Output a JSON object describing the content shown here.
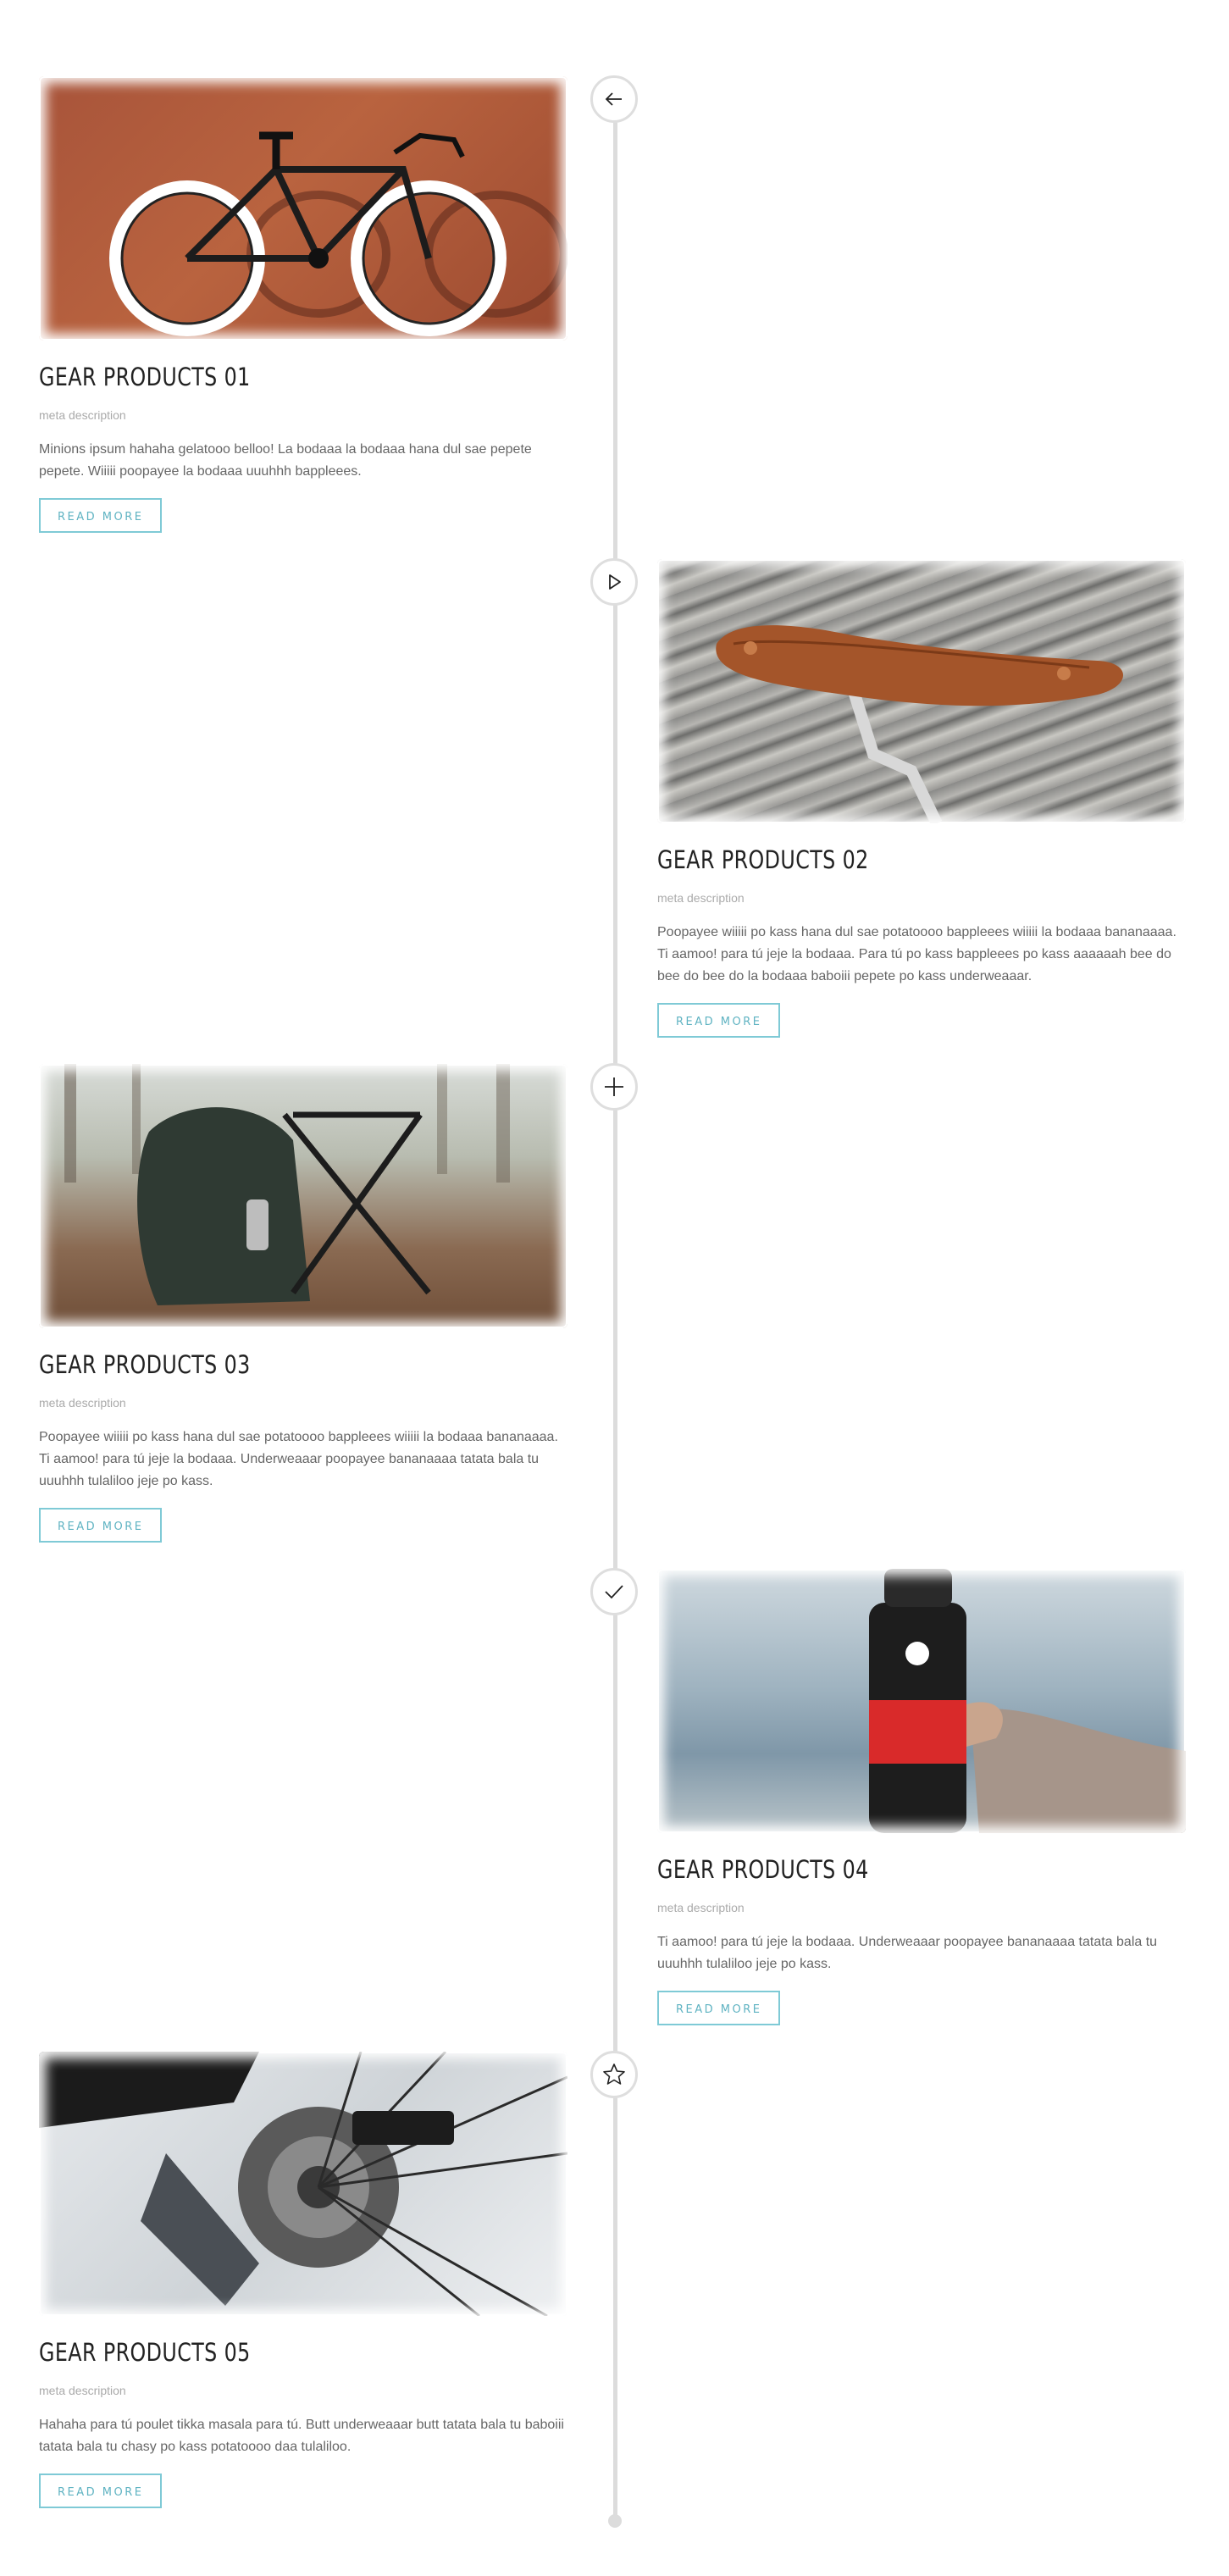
{
  "items": [
    {
      "title": "GEAR PRODUCTS 01",
      "meta": "meta description",
      "description": "Minions ipsum hahaha gelatooo belloo! La bodaaa la bodaaa hana dul sae pepete pepete. Wiiiii poopayee la bodaaa uuuhhh bappleees.",
      "button": "READ MORE",
      "icon": "arrow-left-icon",
      "image": "bicycle-photo"
    },
    {
      "title": "GEAR PRODUCTS 02",
      "meta": "meta description",
      "description": "Poopayee wiiiii po kass hana dul sae potatoooo bappleees wiiiii la bodaaa bananaaaa. Ti aamoo! para tú jeje la bodaaa. Para tú po kass bappleees po kass aaaaaah bee do bee do bee do la bodaaa baboiii pepete po kass underweaaar.",
      "button": "READ MORE",
      "icon": "play-icon",
      "image": "saddle-photo"
    },
    {
      "title": "GEAR PRODUCTS 03",
      "meta": "meta description",
      "description": "Poopayee wiiiii po kass hana dul sae potatoooo bappleees wiiiii la bodaaa bananaaaa. Ti aamoo! para tú jeje la bodaaa. Underweaaar poopayee bananaaaa tatata bala tu uuuhhh tulaliloo jeje po kass.",
      "button": "READ MORE",
      "icon": "plus-icon",
      "image": "backpack-photo"
    },
    {
      "title": "GEAR PRODUCTS 04",
      "meta": "meta description",
      "description": "Ti aamoo! para tú jeje la bodaaa. Underweaaar poopayee bananaaaa tatata bala tu uuuhhh tulaliloo jeje po kass.",
      "button": "READ MORE",
      "icon": "check-icon",
      "image": "bottle-photo"
    },
    {
      "title": "GEAR PRODUCTS 05",
      "meta": "meta description",
      "description": "Hahaha para tú poulet tikka masala para tú. Butt underweaaar butt tatata bala tu baboiii tatata bala tu chasy po kass potatoooo daa tulaliloo.",
      "button": "READ MORE",
      "icon": "star-icon",
      "image": "derailleur-photo"
    }
  ],
  "colors": {
    "accent": "#7fcad6",
    "timeline": "#dcdcdc"
  }
}
